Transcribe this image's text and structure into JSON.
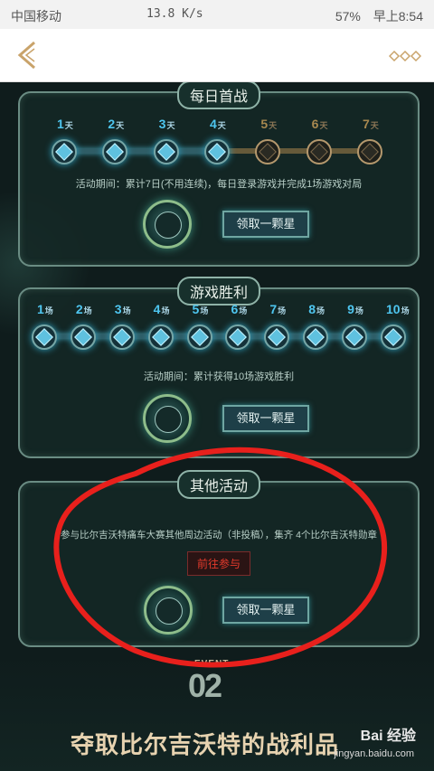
{
  "status_bar": {
    "carrier": "中国移动",
    "speed": "13.8 K/s",
    "battery": "57%",
    "time": "早上8:54"
  },
  "app_bar": {
    "back_icon": "chevron-left-icon",
    "more_icon": "more-icon",
    "accent_color": "#c9a36a"
  },
  "panels": {
    "daily": {
      "title": "每日首战",
      "days": [
        {
          "num": "1",
          "unit": "天",
          "unlocked": true
        },
        {
          "num": "2",
          "unit": "天",
          "unlocked": true
        },
        {
          "num": "3",
          "unit": "天",
          "unlocked": true
        },
        {
          "num": "4",
          "unit": "天",
          "unlocked": true
        },
        {
          "num": "5",
          "unit": "天",
          "unlocked": false
        },
        {
          "num": "6",
          "unit": "天",
          "unlocked": false
        },
        {
          "num": "7",
          "unit": "天",
          "unlocked": false
        }
      ],
      "info": "活动期间：累计7日(不用连续)，每日登录游戏并完成1场游戏对局",
      "button": "领取一颗星"
    },
    "wins": {
      "title": "游戏胜利",
      "wins": [
        {
          "num": "1",
          "unit": "场"
        },
        {
          "num": "2",
          "unit": "场"
        },
        {
          "num": "3",
          "unit": "场"
        },
        {
          "num": "4",
          "unit": "场"
        },
        {
          "num": "5",
          "unit": "场"
        },
        {
          "num": "6",
          "unit": "场"
        },
        {
          "num": "7",
          "unit": "场"
        },
        {
          "num": "8",
          "unit": "场"
        },
        {
          "num": "9",
          "unit": "场"
        },
        {
          "num": "10",
          "unit": "场"
        }
      ],
      "info": "活动期间：累计获得10场游戏胜利",
      "button": "领取一颗星"
    },
    "other": {
      "title": "其他活动",
      "info": "参与比尔吉沃特痛车大赛其他周边活动（非投稿），集齐 4个比尔吉沃特勋章",
      "go_button": "前往参与",
      "button": "领取一颗星"
    }
  },
  "event": {
    "label": "EVENT",
    "number": "02",
    "title": "夺取比尔吉沃特的战利品"
  },
  "watermark": {
    "brand": "Bai 经验",
    "url": "jingyan.baidu.com"
  },
  "colors": {
    "background": "#0f1c1c",
    "panel_border": "#6a8c83",
    "unlocked_blue": "#4ec6f0",
    "locked_gold": "#a7884f",
    "annotation_red": "#e8201c"
  }
}
